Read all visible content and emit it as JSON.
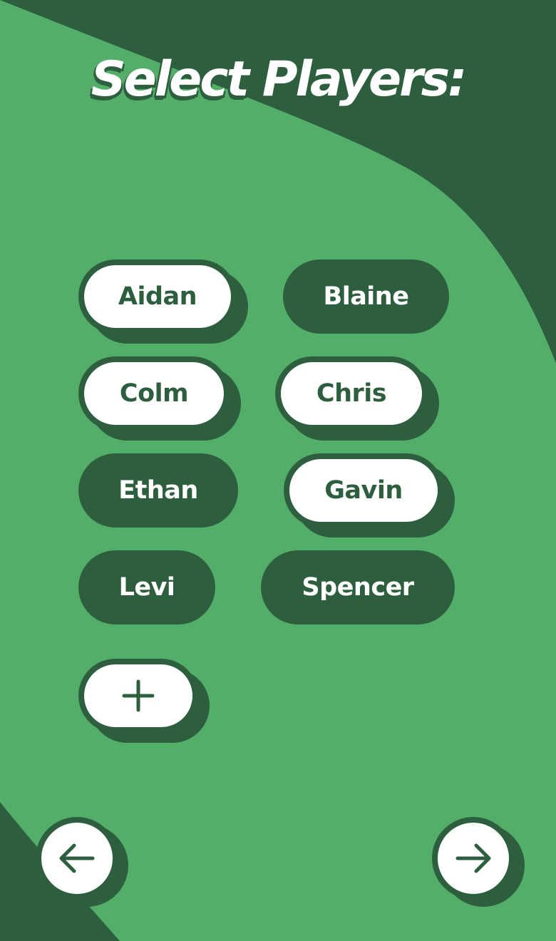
{
  "colors": {
    "background_light": "#53ae69",
    "background_dark": "#2d5f3e",
    "pill_selected": "#ffffff",
    "text_dark": "#2d5f3e",
    "text_light": "#ffffff"
  },
  "header": {
    "title": "Select Players:"
  },
  "players": [
    {
      "name": "Aidan",
      "selected": true
    },
    {
      "name": "Blaine",
      "selected": false
    },
    {
      "name": "Colm",
      "selected": true
    },
    {
      "name": "Chris",
      "selected": true
    },
    {
      "name": "Ethan",
      "selected": false
    },
    {
      "name": "Gavin",
      "selected": true
    },
    {
      "name": "Levi",
      "selected": false
    },
    {
      "name": "Spencer",
      "selected": false
    }
  ],
  "actions": {
    "add_icon": "plus-icon",
    "back_icon": "arrow-left-icon",
    "next_icon": "arrow-right-icon"
  }
}
